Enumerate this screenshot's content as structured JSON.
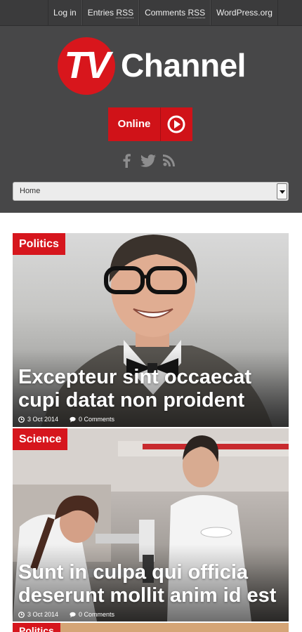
{
  "topnav": {
    "items": [
      "Log in",
      "Entries",
      "Comments",
      "WordPress.org"
    ],
    "rss_suffix": "RSS"
  },
  "header": {
    "logo_badge": "TV",
    "logo_text": "Channel",
    "online_label": "Online",
    "social_icons": [
      "facebook-icon",
      "twitter-icon",
      "rss-icon"
    ],
    "nav_select_value": "Home"
  },
  "articles": [
    {
      "category": "Politics",
      "title": "Excepteur sint occaecat cupi datat non proident",
      "date": "3 Oct 2014",
      "comments": "0 Comments"
    },
    {
      "category": "Science",
      "title": "Sunt in culpa qui officia deserunt mollit anim id est",
      "date": "3 Oct 2014",
      "comments": "0 Comments"
    },
    {
      "category": "Politics"
    }
  ],
  "colors": {
    "accent": "#d6161d",
    "topbar": "#3b3b3c",
    "header": "#474748"
  }
}
